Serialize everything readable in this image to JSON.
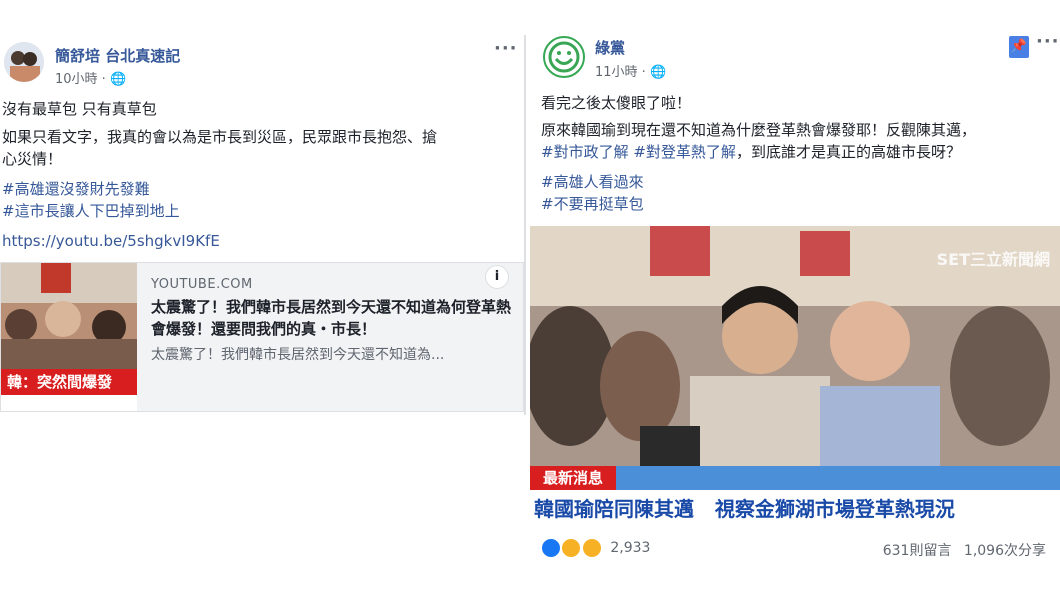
{
  "left_post": {
    "author": "簡舒培 台北真速記",
    "time": "10小時",
    "privacy_icon": "globe-icon",
    "lines": [
      "沒有最草包 只有真草包",
      "如果只看文字，我真的會以為是市長到災區，民眾跟市長抱怨、搶",
      "心災情！"
    ],
    "hashtags": [
      "#高雄還沒發財先發難",
      "#這市長讓人下巴掉到地上"
    ],
    "url": "https://youtu.be/5shgkvI9KfE",
    "link_card": {
      "domain": "YOUTUBE.COM",
      "title": "太震驚了！我們韓市長居然到今天還不知道為何登革熱會爆發！還要問我們的真・市長！",
      "description": "太震驚了！我們韓市長居然到今天還不知道為...",
      "thumb_caption": "韓：突然間爆發",
      "info_label": "i"
    }
  },
  "right_post": {
    "author": "綠黨",
    "time": "11小時",
    "privacy_icon": "globe-icon",
    "lines": [
      "看完之後太傻眼了啦！",
      "原來韓國瑜到現在還不知道為什麼登革熱會爆發耶！反觀陳其邁，"
    ],
    "tags_line_tags": [
      "#對市政了解",
      "#對登革熱了解"
    ],
    "tags_line_tail": "，到底誰才是真正的高雄市長呀？",
    "hashtags": [
      "#高雄人看過來",
      "#不要再挺草包"
    ],
    "video": {
      "watermark": "SET三立新聞網",
      "ticker_label": "最新消息",
      "headline": "韓國瑜陪同陳其邁   視察金獅湖市場登革熱現況"
    },
    "reactions_count": "2,933",
    "comments": "631則留言",
    "shares": "1,096次分享"
  },
  "colors": {
    "link": "#365899",
    "meta": "#616770",
    "news_red": "#d81e1e",
    "news_blue": "#1a4aa8"
  }
}
